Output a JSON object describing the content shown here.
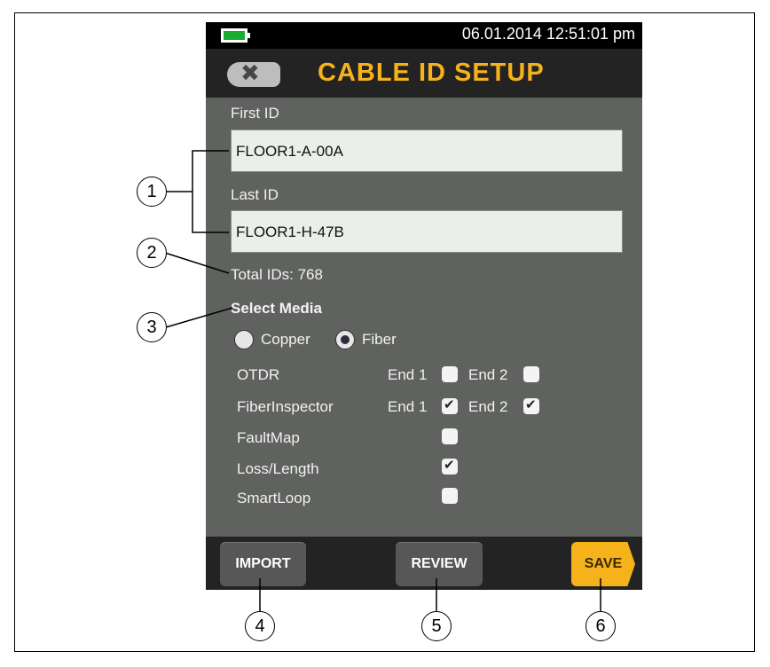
{
  "status": {
    "datetime": "06.01.2014 12:51:01 pm",
    "battery_icon": "battery-icon"
  },
  "header": {
    "title": "CABLE ID SETUP",
    "back_icon": "close-icon"
  },
  "form": {
    "first_id_label": "First ID",
    "first_id_value": "FLOOR1-A-00A",
    "last_id_label": "Last ID",
    "last_id_value": "FLOOR1-H-47B",
    "total_ids": "Total IDs: 768",
    "select_media_label": "Select Media",
    "media_options": [
      {
        "label": "Copper",
        "selected": false
      },
      {
        "label": "Fiber",
        "selected": true
      }
    ],
    "end1_label": "End 1",
    "end2_label": "End 2",
    "tests": [
      {
        "name": "OTDR",
        "end1": false,
        "end2": false
      },
      {
        "name": "FiberInspector",
        "end1": true,
        "end2": true
      },
      {
        "name": "FaultMap",
        "checked": false
      },
      {
        "name": "Loss/Length",
        "checked": true
      },
      {
        "name": "SmartLoop",
        "checked": false
      }
    ]
  },
  "buttons": {
    "import": "IMPORT",
    "review": "REVIEW",
    "save": "SAVE"
  },
  "callouts": [
    "1",
    "2",
    "3",
    "4",
    "5",
    "6"
  ],
  "colors": {
    "accent": "#f5b21b",
    "panel": "#5f625e",
    "bar": "#232323",
    "battery": "#1aae2e"
  }
}
